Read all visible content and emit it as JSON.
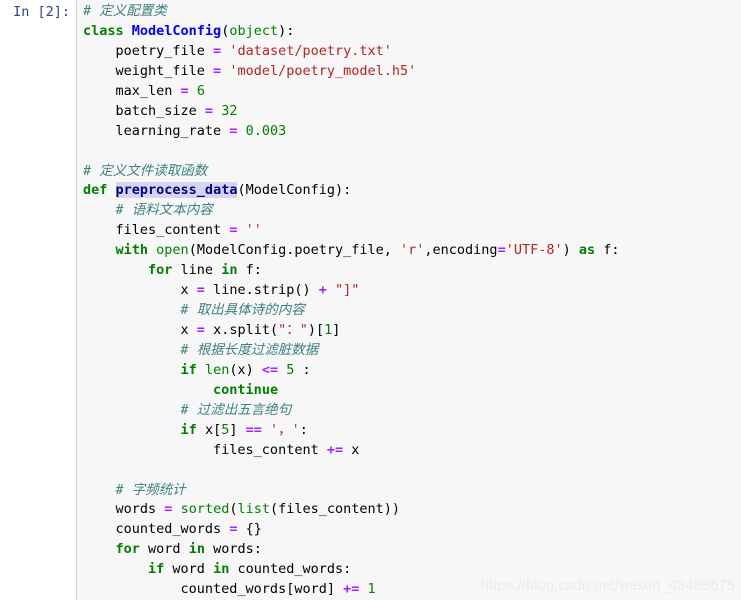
{
  "cell": {
    "prompt_label": "In [2]:",
    "execution_count": 2,
    "selection": "preprocess_data",
    "colors": {
      "cell_background": "#f7f7f7",
      "page_background": "#ffffff",
      "prompt_text": "#303F9F",
      "keyword": "#008000",
      "builtin": "#008000",
      "string": "#BA2121",
      "number": "#008000",
      "operator": "#AA22FF",
      "comment": "#408080",
      "class_name": "#0000FF",
      "function_name": "#00008B",
      "selection_highlight": "#d7d4f0",
      "border": "#cfcfcf",
      "watermark": "#ebebeb"
    },
    "lines": [
      "# 定义配置类",
      "class ModelConfig(object):",
      "    poetry_file = 'dataset/poetry.txt'",
      "    weight_file = 'model/poetry_model.h5'",
      "    max_len = 6",
      "    batch_size = 32",
      "    learning_rate = 0.003",
      "",
      "# 定义文件读取函数",
      "def preprocess_data(ModelConfig):",
      "    # 语料文本内容",
      "    files_content = ''",
      "    with open(ModelConfig.poetry_file, 'r',encoding='UTF-8') as f:",
      "        for line in f:",
      "            x = line.strip() + \"]\"",
      "            # 取出具体诗的内容",
      "            x = x.split(\"：\")[1]",
      "            # 根据长度过滤脏数据",
      "            if len(x) <= 5 :",
      "                continue",
      "            # 过滤出五言绝句",
      "            if x[5] == '，':",
      "                files_content += x",
      "",
      "    # 字频统计",
      "    words = sorted(list(files_content))",
      "    counted_words = {}",
      "    for word in words:",
      "        if word in counted_words:",
      "            counted_words[word] += 1"
    ],
    "comments": {
      "define_config_class": "# 定义配置类",
      "define_file_read_function": "# 定义文件读取函数",
      "corpus_text_content": "# 语料文本内容",
      "extract_poem_content": "# 取出具体诗的内容",
      "filter_dirty_by_length": "# 根据长度过滤脏数据",
      "filter_five_char_quatrain": "# 过滤出五言绝句",
      "word_frequency_stats": "# 字频统计"
    },
    "values": {
      "poetry_file": "'dataset/poetry.txt'",
      "weight_file": "'model/poetry_model.h5'",
      "max_len": "6",
      "batch_size": "32",
      "learning_rate": "0.003",
      "encoding": "'UTF-8'",
      "file_mode": "'r'",
      "length_threshold": "5",
      "index_check": "5",
      "increment": "1"
    }
  },
  "watermark": {
    "text": "https://blog.csdn.net/weixin_43435675"
  }
}
